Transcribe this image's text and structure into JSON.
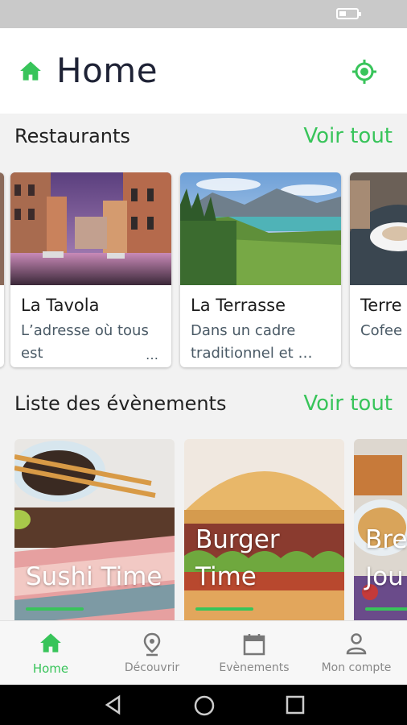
{
  "header": {
    "title": "Home"
  },
  "restaurants": {
    "title": "Restaurants",
    "see_all": "Voir tout",
    "items": [
      {
        "name": "La Tavola",
        "desc": "L’adresse où tous est",
        "more": "…"
      },
      {
        "name": "La Terrasse",
        "desc": "Dans un cadre traditionnel et …"
      },
      {
        "name": "Terre",
        "desc": "Cofee"
      }
    ]
  },
  "events": {
    "title": "Liste des évènements",
    "see_all": "Voir tout",
    "items": [
      {
        "title": "Sushi Time"
      },
      {
        "title_line1": "Burger",
        "title_line2": "Time"
      },
      {
        "title_line1": "Bre",
        "title_line2": "Jou"
      }
    ]
  },
  "bottom_nav": [
    {
      "label": "Home",
      "icon": "home-icon",
      "active": true
    },
    {
      "label": "Découvrir",
      "icon": "location-pin-icon"
    },
    {
      "label": "Evènements",
      "icon": "calendar-icon"
    },
    {
      "label": "Mon compte",
      "icon": "account-icon"
    }
  ],
  "colors": {
    "accent": "#38c45a",
    "title": "#1e2235"
  }
}
